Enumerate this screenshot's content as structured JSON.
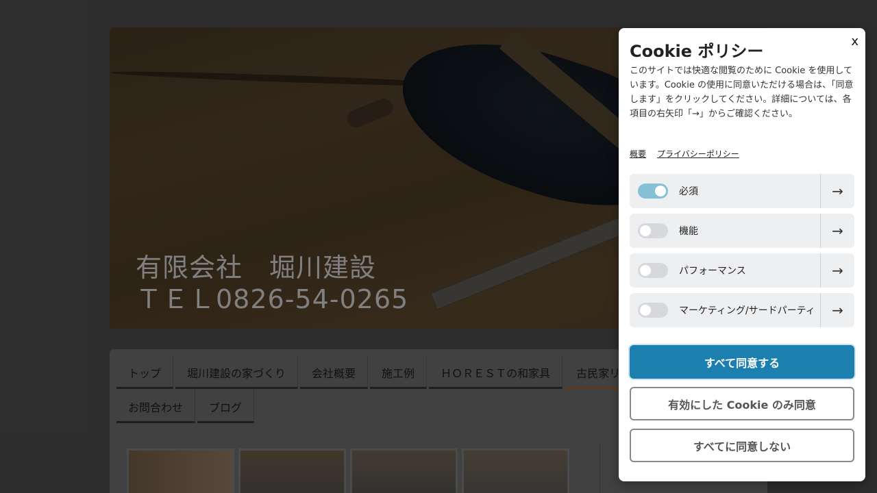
{
  "site": {
    "hero_line1": "有限会社　堀川建設",
    "hero_line2": "ＴＥＬ0826-54-0265"
  },
  "nav": {
    "items": [
      "トップ",
      "堀川建設の家づくり",
      "会社概要",
      "施工例",
      "ＨＯＲＥＳＴの和家具",
      "古民家リフ"
    ],
    "items_row2": [
      "お問合わせ",
      "ブログ"
    ],
    "active_index": 5
  },
  "cookie": {
    "title": "Cookie ポリシー",
    "close_label": "x",
    "description": "このサイトでは快適な閲覧のために Cookie を使用しています。Cookie の使用に同意いただける場合は、「同意します」をクリックしてください。詳細については、各項目の右矢印「→」からご確認ください。",
    "links": [
      "概要",
      "プライバシーポリシー"
    ],
    "categories": [
      {
        "label": "必須",
        "enabled": true
      },
      {
        "label": "機能",
        "enabled": false
      },
      {
        "label": "パフォーマンス",
        "enabled": false
      },
      {
        "label": "マーケティング/サードパーティ",
        "enabled": false
      }
    ],
    "arrow_glyph": "→",
    "accept_all": "すべて同意する",
    "accept_selected": "有効にした Cookie のみ同意",
    "reject_all": "すべてに同意しない"
  },
  "colors": {
    "primary": "#1b7fb0",
    "toggle_on": "#86c0d6",
    "nav_active": "#9b5d2c"
  }
}
